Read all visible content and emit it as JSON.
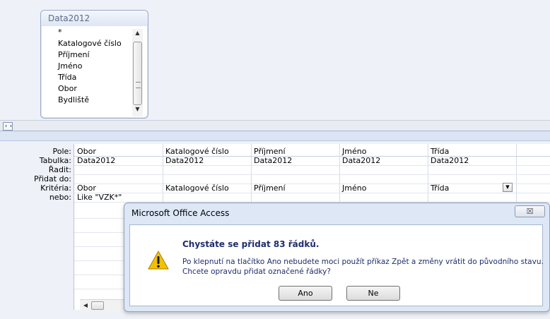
{
  "table": {
    "title": "Data2012",
    "fields": [
      "*",
      "Katalogové číslo",
      "Příjmení",
      "Jméno",
      "Třída",
      "Obor",
      "Bydliště"
    ]
  },
  "grid": {
    "row_labels": [
      "Pole:",
      "Tabulka:",
      "Řadit:",
      "Přidat do:",
      "Kritéria:",
      "nebo:"
    ],
    "columns": [
      {
        "pole": "Obor",
        "tabulka": "Data2012",
        "pridat": "Obor",
        "kriteria": "Like \"VZK*\""
      },
      {
        "pole": "Katalogové číslo",
        "tabulka": "Data2012",
        "pridat": "Katalogové číslo",
        "kriteria": ""
      },
      {
        "pole": "Příjmení",
        "tabulka": "Data2012",
        "pridat": "Příjmení",
        "kriteria": ""
      },
      {
        "pole": "Jméno",
        "tabulka": "Data2012",
        "pridat": "Jméno",
        "kriteria": ""
      },
      {
        "pole": "Třída",
        "tabulka": "Data2012",
        "pridat": "Třída",
        "kriteria": ""
      }
    ]
  },
  "dialog": {
    "title": "Microsoft Office Access",
    "heading": "Chystáte se přidat 83 řádků.",
    "message_line1": "Po klepnutí na tlačítko Ano nebudete moci použít příkaz Zpět a změny vrátit do původního stavu.",
    "message_line2": "Chcete opravdu přidat označené řádky?",
    "yes_label": "Ano",
    "no_label": "Ne",
    "close_label": "☒"
  },
  "colors": {
    "dialog_text": "#1f2d6b",
    "dialog_bg": "#dde7f6",
    "warning_yellow": "#f2c200"
  }
}
